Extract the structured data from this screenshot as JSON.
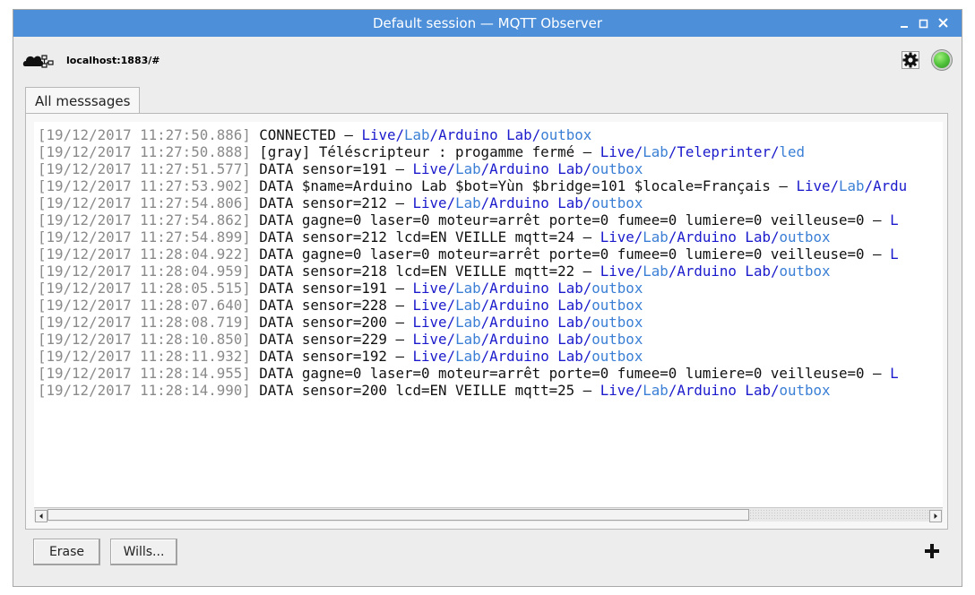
{
  "window": {
    "title": "Default session — MQTT Observer",
    "controls": [
      "minimize-icon",
      "maximize-icon",
      "close-icon"
    ]
  },
  "toolbar": {
    "broker_icon": "cloud-network-icon",
    "broker_address": "localhost:1883/#",
    "settings_icon": "gear-icon",
    "status_led_color": "#4fc13a"
  },
  "tabs": [
    {
      "label": "All messsages",
      "active": true
    }
  ],
  "log": [
    {
      "timestamp": "[19/12/2017 11:27:50.886]",
      "message": "CONNECTED",
      "topic": [
        "Live",
        "Lab",
        "Arduino Lab",
        "outbox"
      ]
    },
    {
      "timestamp": "[19/12/2017 11:27:50.888]",
      "message": "[gray] Téléscripteur : progamme fermé",
      "topic": [
        "Live",
        "Lab",
        "Teleprinter",
        "led"
      ]
    },
    {
      "timestamp": "[19/12/2017 11:27:51.577]",
      "message": "DATA sensor=191",
      "topic": [
        "Live",
        "Lab",
        "Arduino Lab",
        "outbox"
      ]
    },
    {
      "timestamp": "[19/12/2017 11:27:53.902]",
      "message": "DATA $name=Arduino Lab $bot=Yùn $bridge=101 $locale=Français",
      "topic": [
        "Live",
        "Lab",
        "Ardu"
      ]
    },
    {
      "timestamp": "[19/12/2017 11:27:54.806]",
      "message": "DATA sensor=212",
      "topic": [
        "Live",
        "Lab",
        "Arduino Lab",
        "outbox"
      ]
    },
    {
      "timestamp": "[19/12/2017 11:27:54.862]",
      "message": "DATA gagne=0 laser=0 moteur=arrêt porte=0 fumee=0 lumiere=0 veilleuse=0",
      "topic": [
        "L"
      ]
    },
    {
      "timestamp": "[19/12/2017 11:27:54.899]",
      "message": "DATA sensor=212 lcd=EN VEILLE mqtt=24",
      "topic": [
        "Live",
        "Lab",
        "Arduino Lab",
        "outbox"
      ]
    },
    {
      "timestamp": "[19/12/2017 11:28:04.922]",
      "message": "DATA gagne=0 laser=0 moteur=arrêt porte=0 fumee=0 lumiere=0 veilleuse=0",
      "topic": [
        "L"
      ]
    },
    {
      "timestamp": "[19/12/2017 11:28:04.959]",
      "message": "DATA sensor=218 lcd=EN VEILLE mqtt=22",
      "topic": [
        "Live",
        "Lab",
        "Arduino Lab",
        "outbox"
      ]
    },
    {
      "timestamp": "[19/12/2017 11:28:05.515]",
      "message": "DATA sensor=191",
      "topic": [
        "Live",
        "Lab",
        "Arduino Lab",
        "outbox"
      ]
    },
    {
      "timestamp": "[19/12/2017 11:28:07.640]",
      "message": "DATA sensor=228",
      "topic": [
        "Live",
        "Lab",
        "Arduino Lab",
        "outbox"
      ]
    },
    {
      "timestamp": "[19/12/2017 11:28:08.719]",
      "message": "DATA sensor=200",
      "topic": [
        "Live",
        "Lab",
        "Arduino Lab",
        "outbox"
      ]
    },
    {
      "timestamp": "[19/12/2017 11:28:10.850]",
      "message": "DATA sensor=229",
      "topic": [
        "Live",
        "Lab",
        "Arduino Lab",
        "outbox"
      ]
    },
    {
      "timestamp": "[19/12/2017 11:28:11.932]",
      "message": "DATA sensor=192",
      "topic": [
        "Live",
        "Lab",
        "Arduino Lab",
        "outbox"
      ]
    },
    {
      "timestamp": "[19/12/2017 11:28:14.955]",
      "message": "DATA gagne=0 laser=0 moteur=arrêt porte=0 fumee=0 lumiere=0 veilleuse=0",
      "topic": [
        "L"
      ]
    },
    {
      "timestamp": "[19/12/2017 11:28:14.990]",
      "message": "DATA sensor=200 lcd=EN VEILLE mqtt=25",
      "topic": [
        "Live",
        "Lab",
        "Arduino Lab",
        "outbox"
      ]
    }
  ],
  "scrollbar": {
    "horizontal_thumb_fraction": 0.78
  },
  "buttons": {
    "erase": "Erase",
    "wills": "Wills...",
    "add_icon": "plus-icon"
  },
  "colors": {
    "titlebar": "#4d8fd9",
    "timestamp": "#8a8a8a",
    "topic_primary": "#1a1acc",
    "topic_alt": "#3a7fd5"
  }
}
